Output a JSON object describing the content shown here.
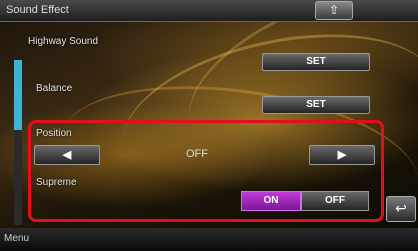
{
  "header": {
    "title": "Sound Effect",
    "back_icon": "arrow-up-icon"
  },
  "rows": {
    "high_sound": {
      "label": "Highway Sound",
      "button": "SET"
    },
    "balance": {
      "label": "Balance",
      "button": "SET"
    },
    "center": {
      "label": "Position",
      "left_arrow": "◀",
      "value": "OFF",
      "right_arrow": "▶"
    },
    "supreme": {
      "label": "Supreme",
      "on": "ON",
      "off": "OFF",
      "selected": "ON"
    }
  },
  "colors": {
    "accent_on": "#b030d0",
    "highlight_box": "#e2101c",
    "scroll_thumb": "#3cb4d8"
  },
  "footer": {
    "menu": "Menu",
    "return_icon": "return-arrow-icon"
  }
}
